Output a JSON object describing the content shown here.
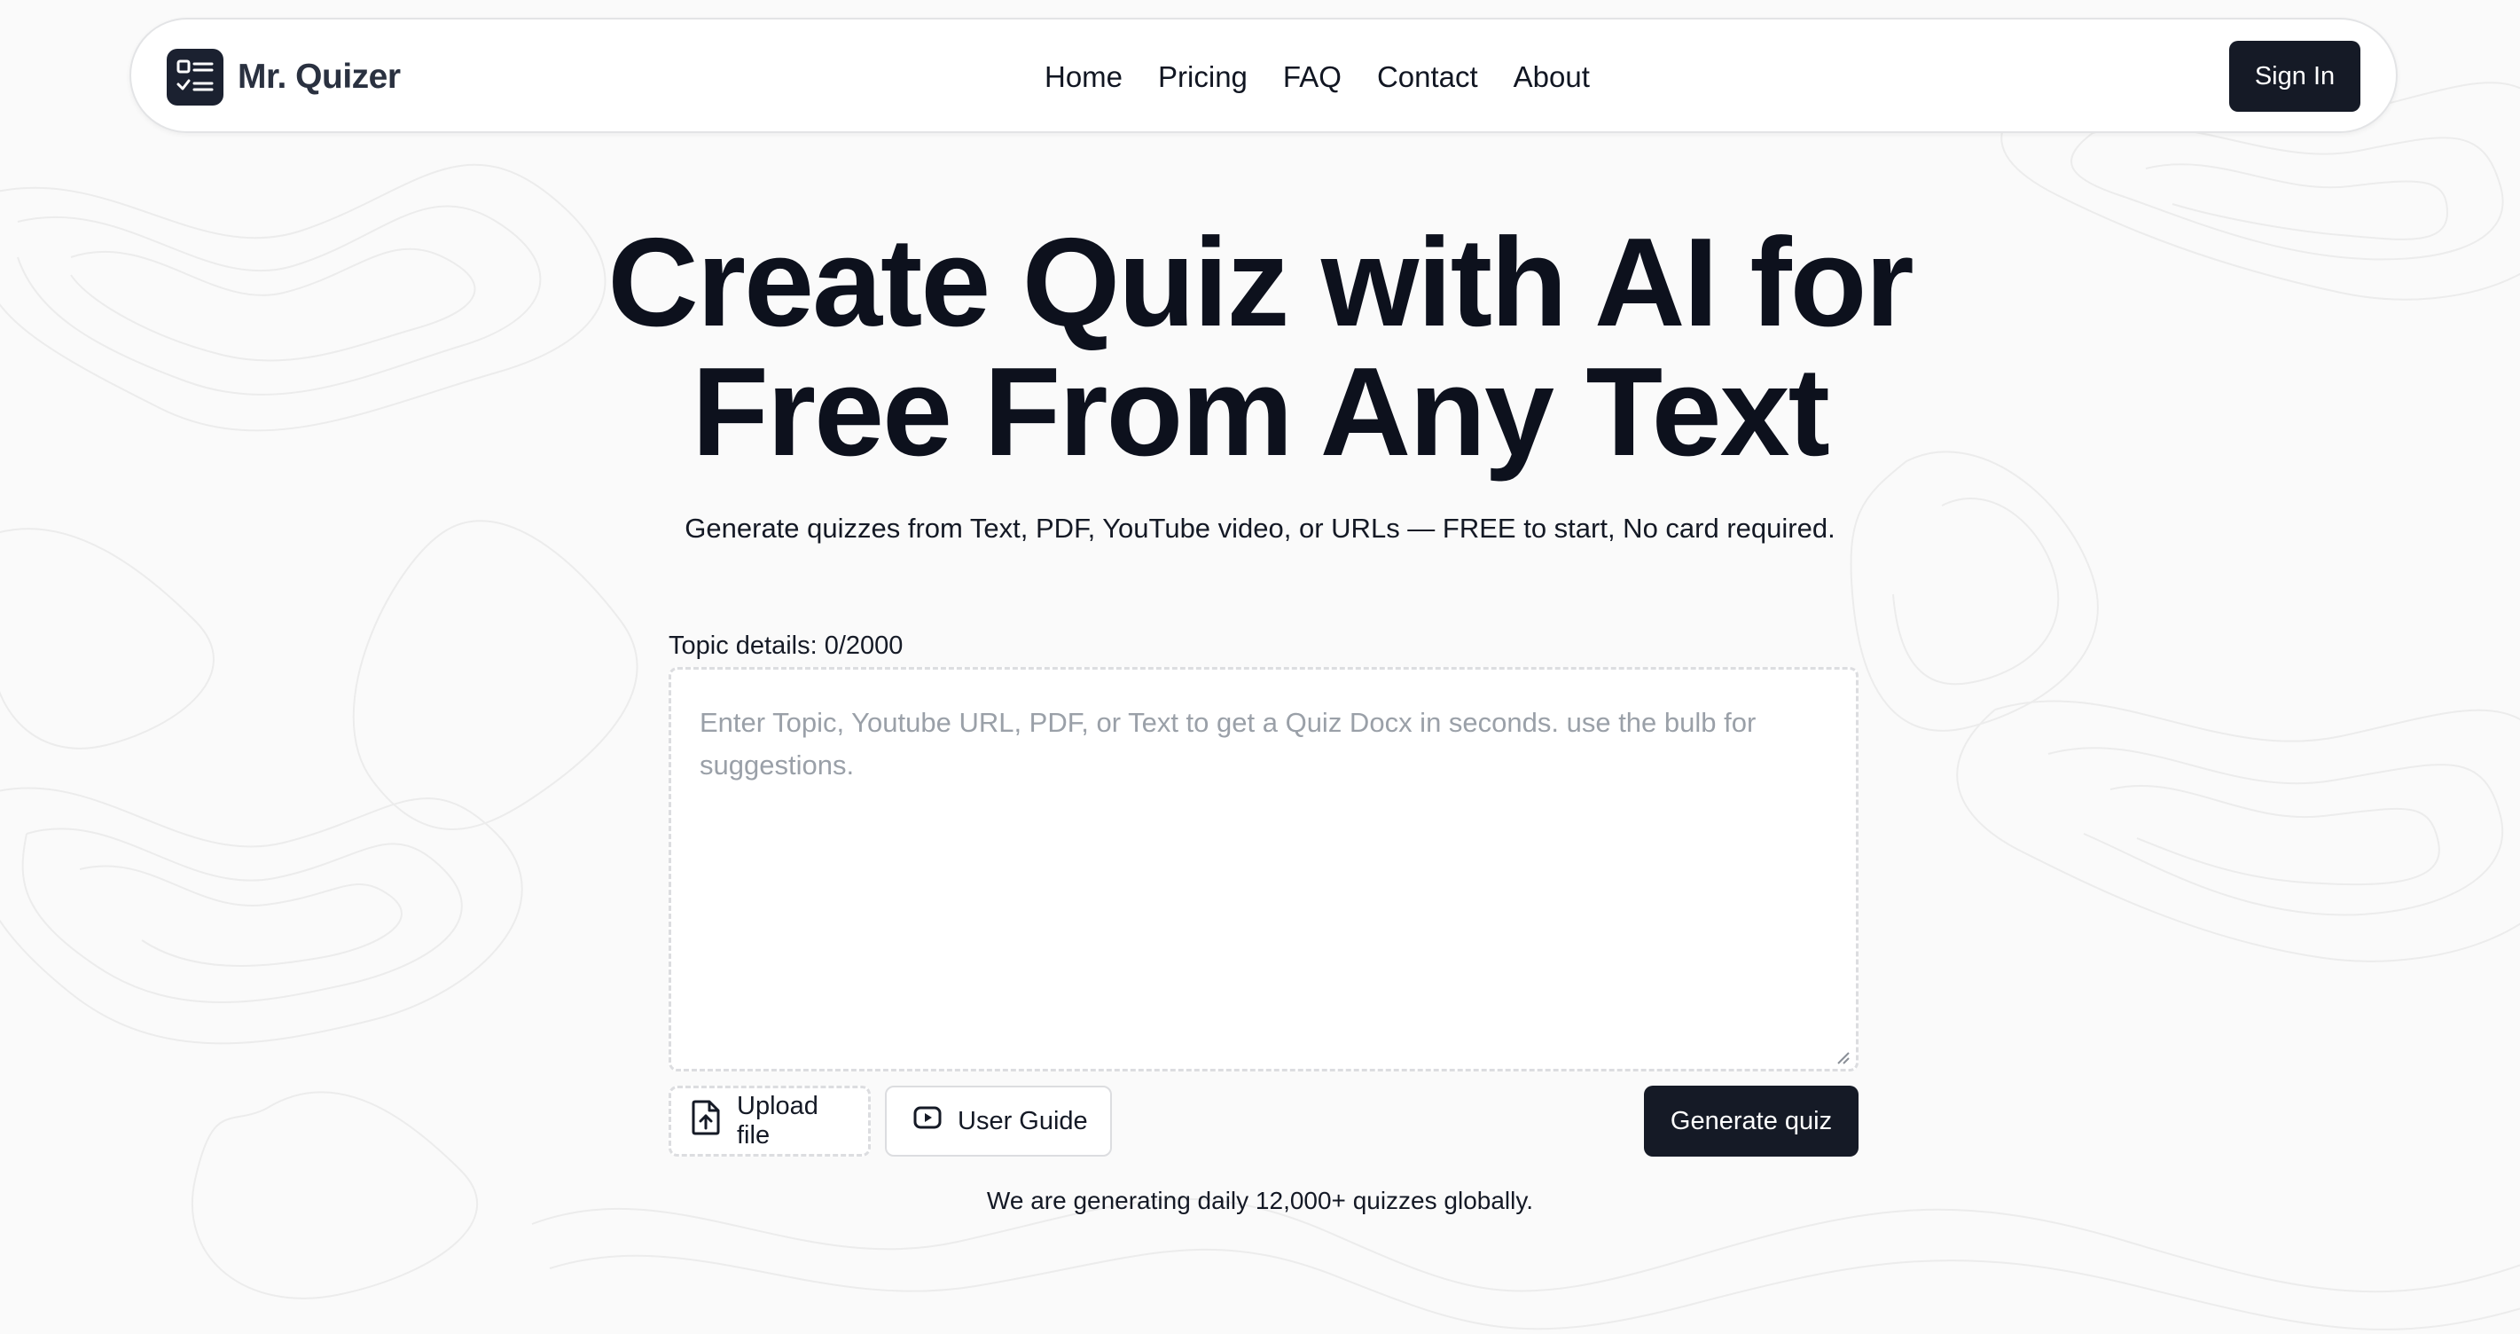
{
  "brand": {
    "name": "Mr. Quizer",
    "icon": "checklist-icon"
  },
  "nav": {
    "items": [
      "Home",
      "Pricing",
      "FAQ",
      "Contact",
      "About"
    ],
    "signin_label": "Sign In"
  },
  "hero": {
    "title_line1": "Create Quiz with AI for",
    "title_line2": "Free From Any Text",
    "subtitle": "Generate quizzes from Text, PDF, YouTube video, or URLs — FREE to start, No card required."
  },
  "form": {
    "topic_label": "Topic details: 0/2000",
    "placeholder": "Enter Topic, Youtube URL, PDF, or Text to get a Quiz Docx in seconds. use the bulb for suggestions.",
    "value": "",
    "upload_label": "Upload file",
    "upload_icon": "file-upload-icon",
    "guide_label": "User Guide",
    "guide_icon": "video-play-icon",
    "generate_label": "Generate quiz"
  },
  "footer_note": "We are generating daily 12,000+ quizzes globally.",
  "colors": {
    "primary": "#151a26",
    "background": "#fafafa",
    "placeholder": "#9aa0a8",
    "border": "#dcdde0"
  }
}
